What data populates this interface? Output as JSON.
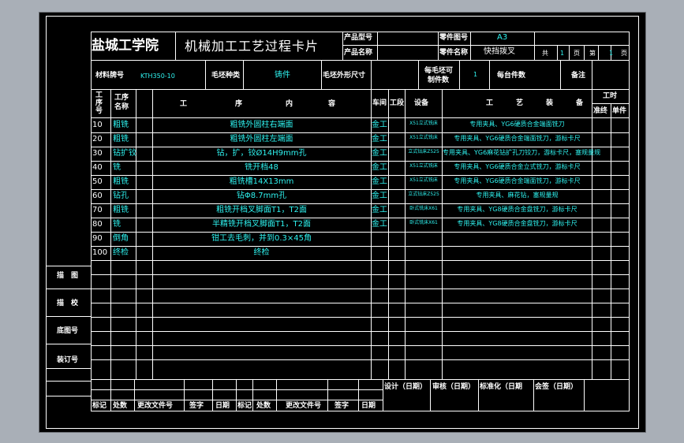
{
  "header": {
    "school": "盐城工学院",
    "doc_title": "机械加工工艺过程卡片",
    "product_model_label": "产品型号",
    "product_name_label": "产品名称",
    "part_number_label": "零件图号",
    "part_number_value": "A3",
    "part_name_label": "零件名称",
    "part_name_value": "快挡拨叉",
    "total_label": "共",
    "total_value": "1",
    "page_label": "页",
    "current_label": "第",
    "current_value": "1",
    "page_label2": "页"
  },
  "material_row": {
    "material_label": "材料牌号",
    "material_value": "KTH350-10",
    "blank_type_label": "毛坯种类",
    "blank_type_value": "铸件",
    "blank_size_label": "毛坯外形尺寸",
    "per_blank_label_1": "每毛坯可",
    "per_blank_label_2": "制件数",
    "per_blank_value": "1",
    "per_unit_label": "每台件数",
    "remarks_label": "备注"
  },
  "columns": {
    "step_no_1": "工",
    "step_no_2": "序",
    "step_no_3": "号",
    "step_name_1": "工序",
    "step_name_2": "名称",
    "content_1": "工",
    "content_2": "序",
    "content_3": "内",
    "content_4": "容",
    "workshop": "车间",
    "section": "工段",
    "equipment": "设备",
    "tooling_1": "工",
    "tooling_2": "艺",
    "tooling_3": "装",
    "tooling_4": "备",
    "time": "工时",
    "prep_time": "准终",
    "unit_time": "单件"
  },
  "rows": [
    {
      "no": "10",
      "name": "粗铣",
      "content": "粗铣外圆柱右端面",
      "workshop": "金工",
      "equipment": "X51立式铣床",
      "tooling": "专用夹具、YG6硬质合金端面铣刀"
    },
    {
      "no": "20",
      "name": "粗铣",
      "content": "粗铣外圆柱左端面",
      "workshop": "金工",
      "equipment": "X51立式铣床",
      "tooling": "专用夹具、YG6硬质合金端面铣刀，游标卡尺"
    },
    {
      "no": "30",
      "name": "钻扩铰",
      "content": "钻，扩，铰Ø14H9mm孔",
      "workshop": "金工",
      "equipment": "立式钻床Z525",
      "tooling": "专用夹具、YG6麻花钻扩孔刀铰刀，游标卡尺，塞规量规"
    },
    {
      "no": "40",
      "name": "铣",
      "content": "铣开档48",
      "workshop": "金工",
      "equipment": "X51立式铣床",
      "tooling": "专用夹具、YG6硬质合金立式铣刀，游标卡尺"
    },
    {
      "no": "50",
      "name": "粗铣",
      "content": "粗铣槽14X13mm",
      "workshop": "金工",
      "equipment": "X51立式铣床",
      "tooling": "专用夹具、YG6硬质合金端面铣刀，游标卡尺"
    },
    {
      "no": "60",
      "name": "钻孔",
      "content": "钻Φ8.7mm孔",
      "workshop": "金工",
      "equipment": "立式钻床Z525",
      "tooling": "专用夹具、麻花钻，塞规量规"
    },
    {
      "no": "70",
      "name": "粗铣",
      "content": "粗铣开档叉脚面T1，T2面",
      "workshop": "金工",
      "equipment": "卧式铣床X61",
      "tooling": "专用夹具、YG8硬质合金盘铣刀，游标卡尺"
    },
    {
      "no": "80",
      "name": "铣",
      "content": "半精铣开档叉脚面T1，T2面",
      "workshop": "金工",
      "equipment": "卧式铣床X61",
      "tooling": "专用夹具、YG8硬质合金盘铣刀，游标卡尺"
    },
    {
      "no": "90",
      "name": "倒角",
      "content": "钳工去毛刺，并到0.3×45角",
      "workshop": "",
      "equipment": "",
      "tooling": ""
    },
    {
      "no": "100",
      "name": "终检",
      "content": "终检",
      "workshop": "",
      "equipment": "",
      "tooling": ""
    }
  ],
  "side_labels": {
    "drawn": "描　图",
    "checked": "描　校",
    "base_drawing_no": "底图号",
    "binding_no": "装订号"
  },
  "footer": {
    "mark": "标记",
    "count": "处数",
    "change_doc": "更改文件号",
    "sign": "签字",
    "date": "日期",
    "mark2": "标记",
    "count2": "处数",
    "change_doc2": "更改文件号",
    "sign2": "签字",
    "date2": "日期",
    "design": "设计（日期）",
    "review": "审核（日期）",
    "standardize": "标准化（日期",
    "countersign": "会签（日期）"
  }
}
